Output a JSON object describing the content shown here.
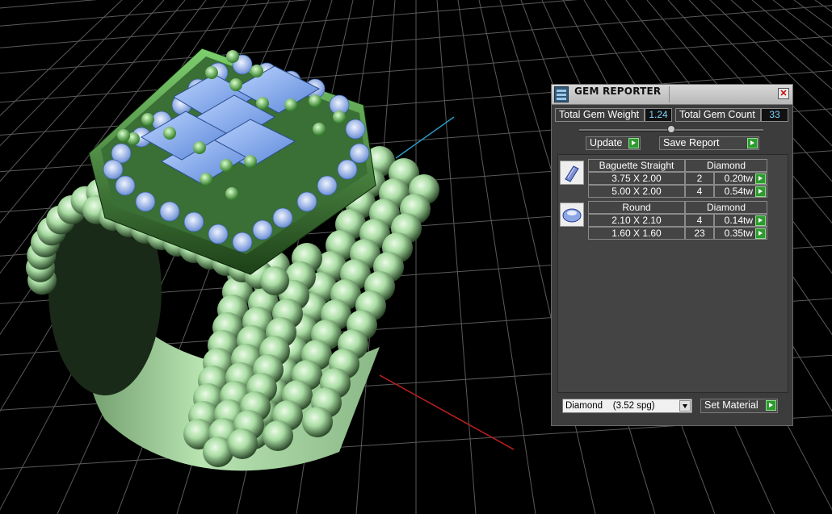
{
  "viewport": {
    "scene": "ring-model-3d",
    "background_color": "#000000",
    "grid_color": "#5a5a5a"
  },
  "panel": {
    "title": "GEM REPORTER",
    "total_weight_label": "Total Gem Weight",
    "total_weight_value": "1.24",
    "total_count_label": "Total Gem Count",
    "total_count_value": "33",
    "update_label": "Update",
    "save_report_label": "Save Report",
    "groups": [
      {
        "icon": "baguette-gem-icon",
        "shape": "Baguette Straight",
        "material": "Diamond",
        "rows": [
          {
            "size": "3.75 X 2.00",
            "count": "2",
            "weight": "0.20tw"
          },
          {
            "size": "5.00 X 2.00",
            "count": "4",
            "weight": "0.54tw"
          }
        ]
      },
      {
        "icon": "round-gem-icon",
        "shape": "Round",
        "material": "Diamond",
        "rows": [
          {
            "size": "2.10 X 2.10",
            "count": "4",
            "weight": "0.14tw"
          },
          {
            "size": "1.60 X 1.60",
            "count": "23",
            "weight": "0.35tw"
          }
        ]
      }
    ],
    "material_select": "Diamond    (3.52 spg)",
    "set_material_label": "Set Material"
  }
}
